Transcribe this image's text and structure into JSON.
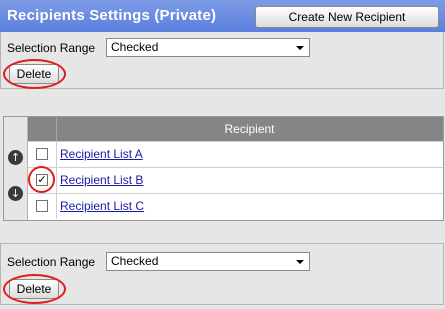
{
  "header": {
    "title": "Recipients Settings (Private)",
    "create_button": "Create New Recipient"
  },
  "top_controls": {
    "selection_label": "Selection Range",
    "selection_value": "Checked",
    "delete_label": "Delete"
  },
  "table": {
    "column_header": "Recipient",
    "move_up_glyph": "↑",
    "move_down_glyph": "↓",
    "rows": [
      {
        "label": "Recipient List A",
        "checked": false
      },
      {
        "label": "Recipient List B",
        "checked": true
      },
      {
        "label": "Recipient List C",
        "checked": false
      }
    ]
  },
  "bottom_controls": {
    "selection_label": "Selection Range",
    "selection_value": "Checked",
    "delete_label": "Delete"
  },
  "colors": {
    "header_bg": "#5b7fde",
    "highlight_ring": "#e21b1b",
    "link": "#1a1aa6"
  },
  "icons": {
    "up": "arrow-up-icon",
    "down": "arrow-down-icon",
    "dropdown": "chevron-down-icon"
  }
}
